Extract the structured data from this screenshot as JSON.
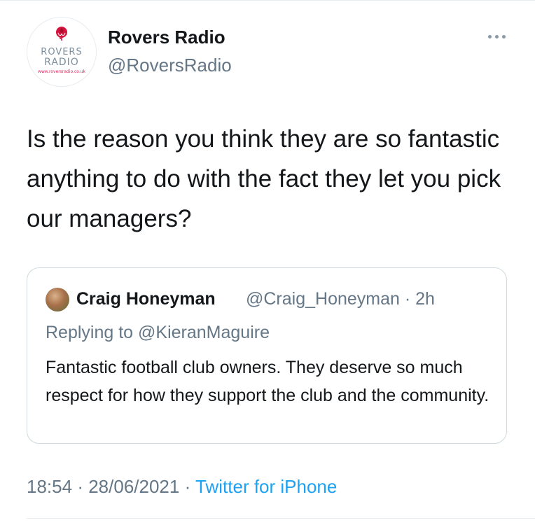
{
  "author": {
    "display_name": "Rovers Radio",
    "handle": "@RoversRadio",
    "avatar_logo": {
      "line1": "ROVERS",
      "line2": "RADIO",
      "url": "www.roversradio.co.uk",
      "icon": "rose-icon",
      "accent_color": "#d4143c"
    }
  },
  "more_menu": {
    "icon": "more-dots-icon"
  },
  "tweet": {
    "text": "Is the reason you think they are so fantastic anything to do with the fact they let you pick our managers?"
  },
  "quoted_tweet": {
    "display_name": "Craig Honeyman",
    "handle": "@Craig_Honeyman",
    "separator": "·",
    "time_ago": "2h",
    "replying_to_label": "Replying to ",
    "replying_to_handle": "@KieranMaguire",
    "text": "Fantastic football club owners. They deserve so much respect for how they support the club and the community."
  },
  "meta": {
    "time": "18:54",
    "separator": "·",
    "date": "28/06/2021",
    "source": "Twitter for iPhone"
  },
  "colors": {
    "text_primary": "#14171a",
    "text_secondary": "#657786",
    "link": "#1da1f2",
    "border": "#cfd9de"
  }
}
